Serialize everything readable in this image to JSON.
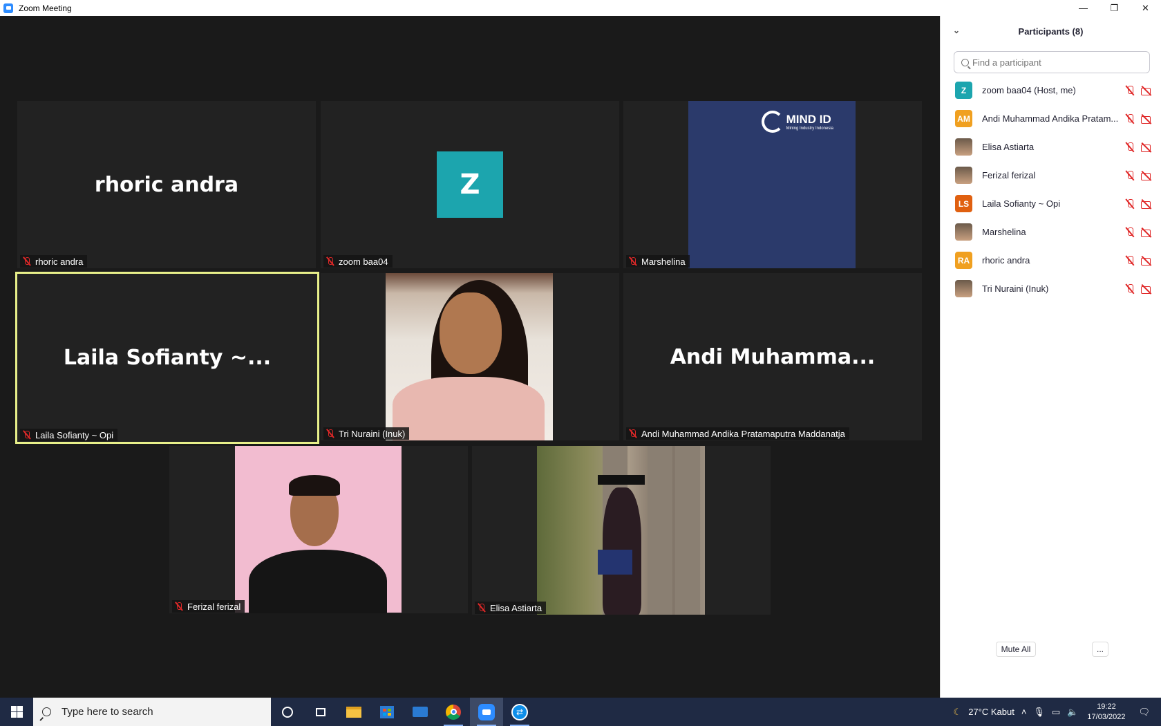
{
  "window": {
    "title": "Zoom Meeting",
    "controls": {
      "minimize": "—",
      "restore": "❐",
      "close": "✕"
    }
  },
  "tiles": [
    {
      "id": "rhoric",
      "big_name": "rhoric andra",
      "label": "rhoric andra",
      "type": "name"
    },
    {
      "id": "zoom",
      "avatar_letter": "Z",
      "label": "zoom baa04",
      "type": "avatar",
      "avatar_color": "#1ca5ae"
    },
    {
      "id": "marshelina",
      "label": "Marshelina",
      "type": "logo",
      "logo_text": "MIND ID",
      "logo_sub": "Mining Industry Indonesia"
    },
    {
      "id": "laila",
      "big_name": "Laila Sofianty ~...",
      "label": "Laila Sofianty ~ Opi",
      "type": "name",
      "active_speaker": true,
      "highlight_color": "#e8f08a"
    },
    {
      "id": "tri",
      "label": "Tri Nuraini (Inuk)",
      "type": "video"
    },
    {
      "id": "andi",
      "big_name": "Andi  Muhamma...",
      "label": "Andi Muhammad Andika Pratamaputra Maddanatja",
      "type": "name"
    },
    {
      "id": "ferizal",
      "label": "Ferizal ferizal",
      "type": "video"
    },
    {
      "id": "elisa",
      "label": "Elisa Astiarta",
      "type": "video"
    }
  ],
  "participants_panel": {
    "title": "Participants (8)",
    "collapse_icon": "chevron-down-icon",
    "search_placeholder": "Find a participant",
    "participants": [
      {
        "name": "zoom baa04 (Host, me)",
        "initials": "Z",
        "color": "#1ca5ae"
      },
      {
        "name": "Andi Muhammad Andika Pratam...",
        "initials": "AM",
        "color": "#f0a020"
      },
      {
        "name": "Elisa Astiarta",
        "initials": "",
        "color": "#7a6a58",
        "photo": true
      },
      {
        "name": "Ferizal ferizal",
        "initials": "",
        "color": "#b08070",
        "photo": true
      },
      {
        "name": "Laila Sofianty ~ Opi",
        "initials": "LS",
        "color": "#e06010"
      },
      {
        "name": "Marshelina",
        "initials": "",
        "color": "#2b3a6b",
        "photo": true
      },
      {
        "name": "rhoric andra",
        "initials": "RA",
        "color": "#f0a020"
      },
      {
        "name": "Tri Nuraini (Inuk)",
        "initials": "",
        "color": "#c89070",
        "photo": true
      }
    ],
    "mute_all_label": "Mute All",
    "more_label": "..."
  },
  "taskbar": {
    "search_placeholder": "Type here to search",
    "weather": "27°C  Kabut",
    "time": "19:22",
    "date": "17/03/2022",
    "colors": {
      "background": "#1f2a44",
      "zoom_blue": "#2d8cff"
    }
  }
}
